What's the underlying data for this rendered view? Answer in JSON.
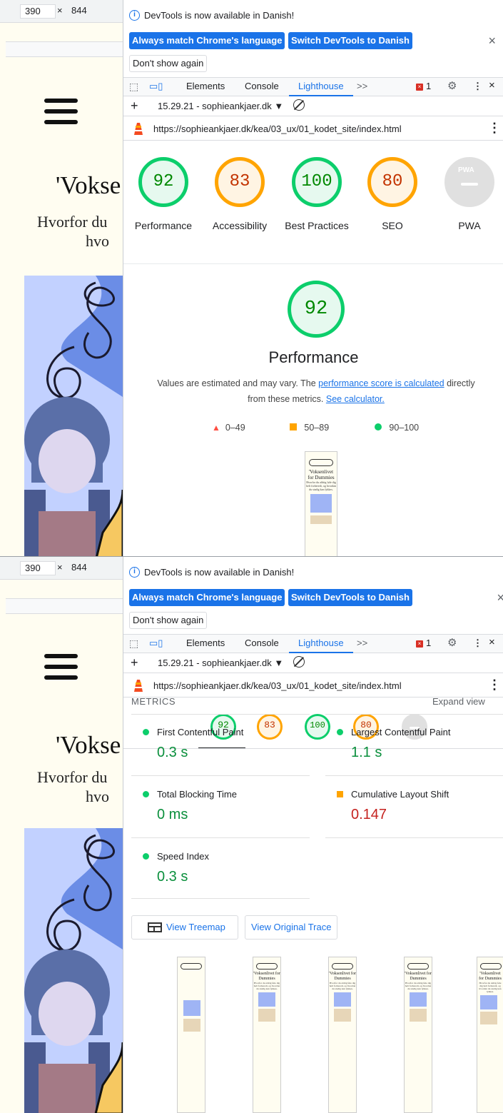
{
  "responsive": {
    "width": "390",
    "x": "×",
    "height": "844"
  },
  "site": {
    "title": "'Vokse",
    "subtitle_line1": "Hvorfor du",
    "subtitle_line2": "hvo"
  },
  "infobar": {
    "message": "DevTools is now available in Danish!",
    "match_button": "Always match Chrome's language",
    "switch_button": "Switch DevTools to Danish",
    "dont_show": "Don't show again",
    "close": "×"
  },
  "tabs": {
    "elements": "Elements",
    "console": "Console",
    "lighthouse": "Lighthouse",
    "more": ">>",
    "errors": "1",
    "menu": "⋮",
    "close": "×"
  },
  "report": {
    "add": "+",
    "selector": "15.29.21 - sophieankjaer.dk ▼",
    "url": "https://sophieankjaer.dk/kea/03_ux/01_kodet_site/index.html",
    "kebab": "⋮"
  },
  "gauges": [
    {
      "score": "92",
      "label": "Performance",
      "status": "green"
    },
    {
      "score": "83",
      "label": "Accessibility",
      "status": "orange"
    },
    {
      "score": "100",
      "label": "Best Practices",
      "status": "green"
    },
    {
      "score": "80",
      "label": "SEO",
      "status": "orange"
    },
    {
      "score": "",
      "label": "PWA",
      "status": "gray",
      "badge": "PWA"
    }
  ],
  "performance": {
    "score": "92",
    "title": "Performance",
    "desc_prefix": "Values are estimated and may vary. The ",
    "desc_link1": "performance score is calculated",
    "desc_middle": " directly from these metrics. ",
    "desc_link2": "See calculator.",
    "legend": [
      {
        "range": "0–49",
        "shape": "triangle",
        "color": "#ff4e42"
      },
      {
        "range": "50–89",
        "shape": "square",
        "color": "#ffa400"
      },
      {
        "range": "90–100",
        "shape": "circle",
        "color": "#0cce6b"
      }
    ]
  },
  "thumbnail": {
    "title": "'Voksenlivet for Dummies",
    "text": "Hvorfor du aldrig føle dig helt forberedt, og hvordan du stadig kan lykkes."
  },
  "metrics": {
    "header": "METRICS",
    "expand": "Expand view",
    "items": [
      {
        "label": "First Contentful Paint",
        "value": "0.3 s",
        "status": "good"
      },
      {
        "label": "Largest Contentful Paint",
        "value": "1.1 s",
        "status": "good"
      },
      {
        "label": "Total Blocking Time",
        "value": "0 ms",
        "status": "good"
      },
      {
        "label": "Cumulative Layout Shift",
        "value": "0.147",
        "status": "average"
      },
      {
        "label": "Speed Index",
        "value": "0.3 s",
        "status": "good"
      }
    ]
  },
  "actions": {
    "treemap": "View Treemap",
    "trace": "View Original Trace"
  },
  "colors": {
    "blue": "#1a73e8",
    "green": "#0cce6b",
    "orange": "#ffa400",
    "red": "#ff4e42"
  }
}
